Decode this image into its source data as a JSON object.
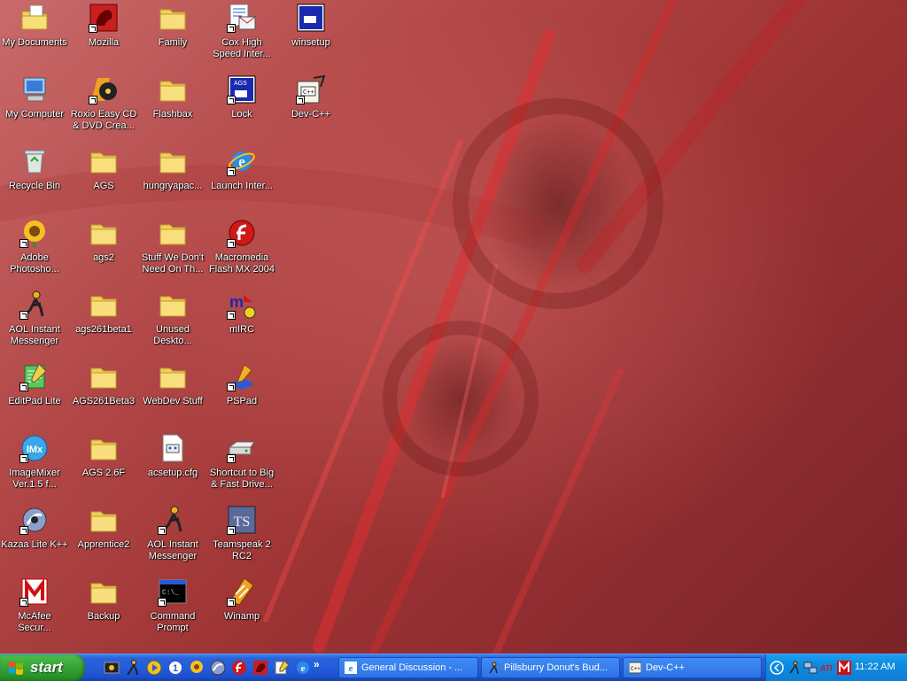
{
  "desktop": {
    "icons": [
      {
        "label": "My Documents",
        "icon": "my-documents-icon"
      },
      {
        "label": "My Computer",
        "icon": "my-computer-icon"
      },
      {
        "label": "Recycle Bin",
        "icon": "recycle-bin-icon"
      },
      {
        "label": "Adobe Photosho...",
        "icon": "photoshop-icon"
      },
      {
        "label": "AOL Instant Messenger",
        "icon": "aim-icon"
      },
      {
        "label": "EditPad Lite",
        "icon": "editpad-icon"
      },
      {
        "label": "ImageMixer Ver.1.5 f...",
        "icon": "imagemixer-icon"
      },
      {
        "label": "Kazaa Lite K++",
        "icon": "kazaa-icon"
      },
      {
        "label": "McAfee Secur...",
        "icon": "mcafee-icon"
      },
      {
        "label": "Mozilla",
        "icon": "mozilla-icon"
      },
      {
        "label": "Roxio Easy CD & DVD Crea...",
        "icon": "roxio-icon"
      },
      {
        "label": "AGS",
        "icon": "folder-icon"
      },
      {
        "label": "ags2",
        "icon": "folder-icon"
      },
      {
        "label": "ags261beta1",
        "icon": "folder-icon"
      },
      {
        "label": "AGS261Beta3",
        "icon": "folder-icon"
      },
      {
        "label": "AGS 2.6F",
        "icon": "folder-icon"
      },
      {
        "label": "Apprentice2",
        "icon": "folder-icon"
      },
      {
        "label": "Backup",
        "icon": "folder-icon"
      },
      {
        "label": "Family",
        "icon": "folder-icon"
      },
      {
        "label": "Flashbax",
        "icon": "folder-icon"
      },
      {
        "label": "hungryapac...",
        "icon": "folder-icon"
      },
      {
        "label": "Stuff We Don't Need On Th...",
        "icon": "folder-icon"
      },
      {
        "label": "Unused Deskto...",
        "icon": "folder-icon"
      },
      {
        "label": "WebDev Stuff",
        "icon": "folder-icon"
      },
      {
        "label": "acsetup.cfg",
        "icon": "config-file-icon"
      },
      {
        "label": "AOL Instant Messenger",
        "icon": "aim-icon"
      },
      {
        "label": "Command Prompt",
        "icon": "command-prompt-icon"
      },
      {
        "label": "Cox High Speed Inter...",
        "icon": "cox-icon"
      },
      {
        "label": "Lock",
        "icon": "ags-lock-icon"
      },
      {
        "label": "Launch Inter...",
        "icon": "internet-explorer-icon"
      },
      {
        "label": "Macromedia Flash MX 2004",
        "icon": "flash-icon"
      },
      {
        "label": "mIRC",
        "icon": "mirc-icon"
      },
      {
        "label": "PSPad",
        "icon": "pspad-icon"
      },
      {
        "label": "Shortcut to Big & Fast Drive...",
        "icon": "drive-icon"
      },
      {
        "label": "Teamspeak 2 RC2",
        "icon": "teamspeak-icon"
      },
      {
        "label": "Winamp",
        "icon": "winamp-icon"
      },
      {
        "label": "winsetup",
        "icon": "winsetup-icon"
      },
      {
        "label": "Dev-C++",
        "icon": "devcpp-icon"
      }
    ]
  },
  "taskbar": {
    "start_label": "start",
    "quick_launch": [
      "media-icon",
      "aim-icon",
      "media-player-icon",
      "info-icon",
      "photoshop-icon",
      "kazaa-icon",
      "flash-icon",
      "mozilla-icon",
      "editor-icon",
      "internet-explorer-icon"
    ],
    "tasks": [
      {
        "label": "General Discussion - ...",
        "icon": "internet-explorer-icon"
      },
      {
        "label": "Pillsburry Donut's Bud...",
        "icon": "aim-icon"
      },
      {
        "label": "Dev-C++",
        "icon": "devcpp-icon"
      }
    ],
    "tray": {
      "icons": [
        "collapse-icon",
        "aim-icon",
        "network-icon",
        "ati-icon",
        "mcafee-icon"
      ],
      "clock": "11:22 AM"
    }
  },
  "colors": {
    "taskbar_blue": "#245ddb",
    "start_green": "#3aa83a",
    "tray_blue": "#0f8ae0",
    "wallpaper_red": "#b34848"
  }
}
